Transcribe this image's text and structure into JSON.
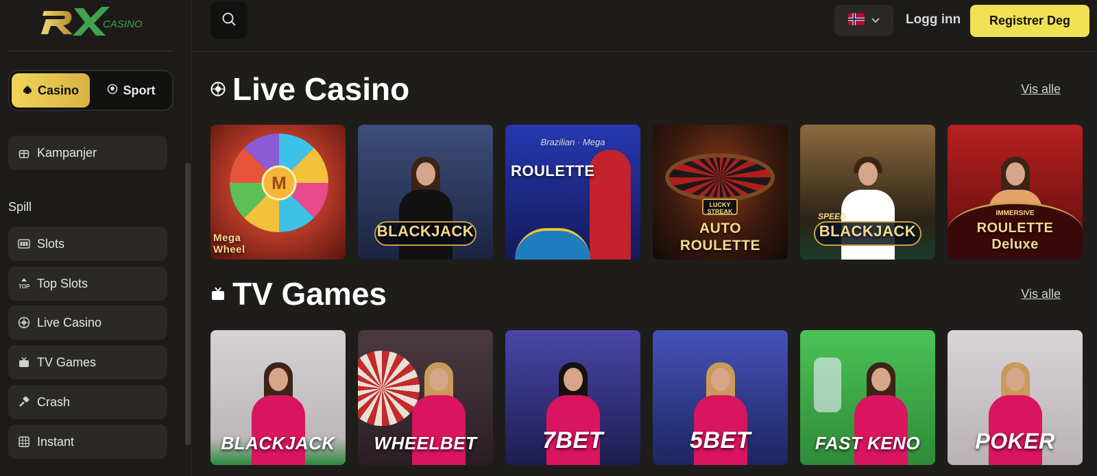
{
  "brand": {
    "logo_text": "RX",
    "logo_sub": "CASINO",
    "accent": "#f0e054",
    "gold": "#d7b344",
    "green": "#3fa34d"
  },
  "mode_toggle": {
    "casino": "Casino",
    "sport": "Sport",
    "active": "casino"
  },
  "sidebar": {
    "promo": "Kampanjer",
    "heading": "Spill",
    "items": [
      {
        "label": "Slots",
        "icon": "slot-machine-icon"
      },
      {
        "label": "Top Slots",
        "icon": "top-icon"
      },
      {
        "label": "Live Casino",
        "icon": "roulette-icon"
      },
      {
        "label": "TV Games",
        "icon": "tv-icon"
      },
      {
        "label": "Crash",
        "icon": "hammer-icon"
      },
      {
        "label": "Instant",
        "icon": "grid-icon"
      }
    ]
  },
  "header": {
    "login": "Logg inn",
    "register": "Registrer Deg",
    "language": "NO"
  },
  "sections": [
    {
      "title": "Live Casino",
      "icon": "roulette-icon",
      "view_all": "Vis alle",
      "games": [
        {
          "title": "Mega Wheel",
          "bg": "#b53a23"
        },
        {
          "title": "BLACKJACK",
          "bg": "#2b3a5c"
        },
        {
          "title": "ROULETTE",
          "subtitle": "Brazilian · Mega",
          "bg": "#1f2d8a"
        },
        {
          "title": "AUTO ROULETTE",
          "subtitle": "LUCKY STREAK",
          "bg": "#2a1a14"
        },
        {
          "title": "BLACKJACK",
          "subtitle": "SPEED",
          "bg": "#5a3d25"
        },
        {
          "title": "ROULETTE Deluxe",
          "subtitle": "IMMERSIVE",
          "bg": "#8b1a1a"
        }
      ]
    },
    {
      "title": "TV Games",
      "icon": "tv-icon",
      "view_all": "Vis alle",
      "games": [
        {
          "title": "BLACKJACK",
          "bg": "#c9c4c6"
        },
        {
          "title": "WHEELBET",
          "bg": "#3a2a2e"
        },
        {
          "title": "7BET",
          "bg": "#2c2a6b"
        },
        {
          "title": "5BET",
          "bg": "#2f3d8a"
        },
        {
          "title": "FAST KENO",
          "bg": "#3fb24a"
        },
        {
          "title": "POKER",
          "bg": "#cfcacd"
        }
      ]
    }
  ]
}
